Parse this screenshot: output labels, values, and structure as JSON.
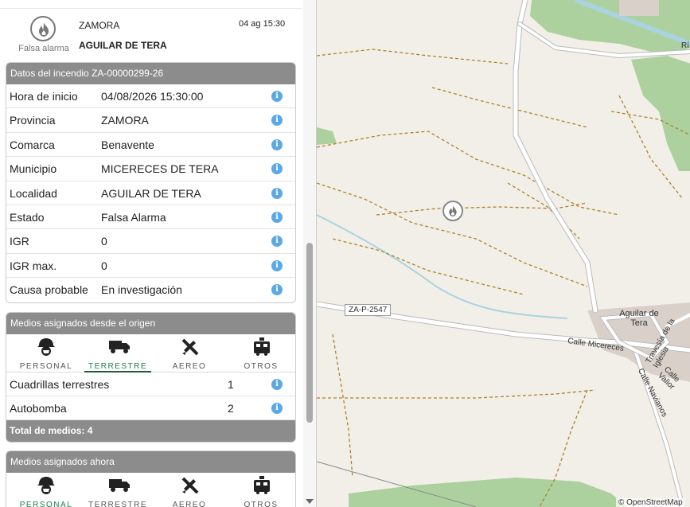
{
  "header": {
    "status_label": "Falsa alarma",
    "province": "ZAMORA",
    "locality": "AGUILAR DE TERA",
    "datetime": "04 ag 15:30"
  },
  "incident": {
    "title": "Datos del incendio ZA-00000299-26",
    "rows": [
      {
        "key": "Hora de inicio",
        "value": "04/08/2026 15:30:00"
      },
      {
        "key": "Provincia",
        "value": "ZAMORA"
      },
      {
        "key": "Comarca",
        "value": "Benavente"
      },
      {
        "key": "Municipio",
        "value": "MICERECES DE TERA"
      },
      {
        "key": "Localidad",
        "value": "AGUILAR DE TERA"
      },
      {
        "key": "Estado",
        "value": "Falsa Alarma"
      },
      {
        "key": "IGR",
        "value": "0"
      },
      {
        "key": "IGR max.",
        "value": "0"
      },
      {
        "key": "Causa probable",
        "value": "En investigación"
      }
    ],
    "info_glyph": "i"
  },
  "origin": {
    "title": "Medios asignados desde el origen",
    "tabs": [
      "PERSONAL",
      "TERRESTRE",
      "AEREO",
      "OTROS"
    ],
    "active_tab": 1,
    "rows": [
      {
        "key": "Cuadrillas terrestres",
        "count": "1"
      },
      {
        "key": "Autobomba",
        "count": "2"
      }
    ],
    "total": "Total de medios: 4"
  },
  "now": {
    "title": "Medios asignados ahora",
    "tabs": [
      "PERSONAL",
      "TERRESTRE",
      "AEREO",
      "OTROS"
    ],
    "active_tab": 0
  },
  "map": {
    "road_shield": "ZA-P-2547",
    "town": "Aguilar de Tera",
    "streets": [
      "Calle Micereces",
      "Travesía de la Iglesia",
      "Calle Navianos",
      "Calle Valior"
    ],
    "river_label": "Rí",
    "attribution": "© OpenStreetMap",
    "colors": {
      "land": "#f2efe9",
      "park": "#add19e",
      "track": "#ac8327",
      "water": "#aad3df"
    }
  },
  "icons": [
    "fire-icon",
    "info-icon",
    "firefighter-icon",
    "truck-icon",
    "plane-icon",
    "fire-engine-icon"
  ]
}
